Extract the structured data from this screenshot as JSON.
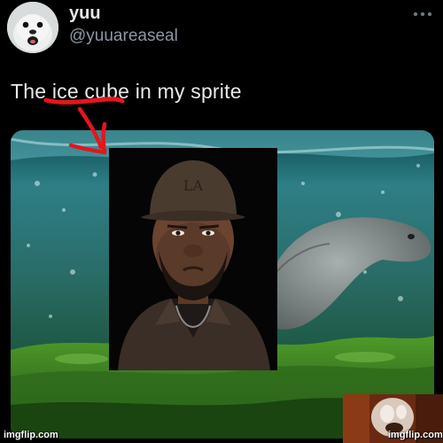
{
  "author": {
    "display_name": "yuu",
    "handle": "@yuuareaseal",
    "avatar_icon": "seal-avatar-icon"
  },
  "header": {
    "more_icon": "more-dots-icon"
  },
  "tweet": {
    "text_before": "The ",
    "text_highlight": "ice cube",
    "text_after": " in my sprite",
    "scribble_color": "#e8141c"
  },
  "media": {
    "main_image": "underwater seal photo",
    "overlay_image": "ice cube portrait",
    "corner_image": "reaction cutout"
  },
  "watermarks": {
    "left": "imgflip.com",
    "right": "imgflip.com"
  }
}
